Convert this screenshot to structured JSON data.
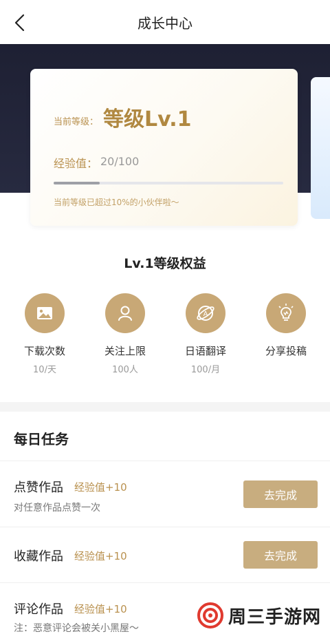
{
  "header": {
    "title": "成长中心"
  },
  "level_card": {
    "current_level_label": "当前等级：",
    "current_level": "等级Lv.1",
    "exp_label": "经验值：",
    "exp_value": "20/100",
    "exp_progress": 0.2,
    "note": "当前等级已超过10%的小伙伴啦〜"
  },
  "benefits": {
    "title": "Lv.1等级权益",
    "items": [
      {
        "label": "下载次数",
        "sub": "10/天",
        "icon": "image-icon"
      },
      {
        "label": "关注上限",
        "sub": "100人",
        "icon": "person-icon"
      },
      {
        "label": "日语翻译",
        "sub": "100/月",
        "icon": "translate-icon"
      },
      {
        "label": "分享投稿",
        "sub": "",
        "icon": "lightbulb-icon"
      }
    ]
  },
  "daily": {
    "title": "每日任务",
    "tasks": [
      {
        "name": "点赞作品",
        "exp": "经验值+10",
        "desc": "对任意作品点赞一次",
        "button": "去完成"
      },
      {
        "name": "收藏作品",
        "exp": "经验值+10",
        "desc": "",
        "button": "去完成"
      },
      {
        "name": "评论作品",
        "exp": "经验值+10",
        "desc": "注：恶意评论会被关小黑屋〜",
        "button": ""
      }
    ]
  },
  "watermark": {
    "text": "周三手游网"
  },
  "colors": {
    "accent_gold": "#c8a876",
    "hero_dark": "#1e2033",
    "level_text": "#b08840",
    "button": "#c8ad7f"
  }
}
